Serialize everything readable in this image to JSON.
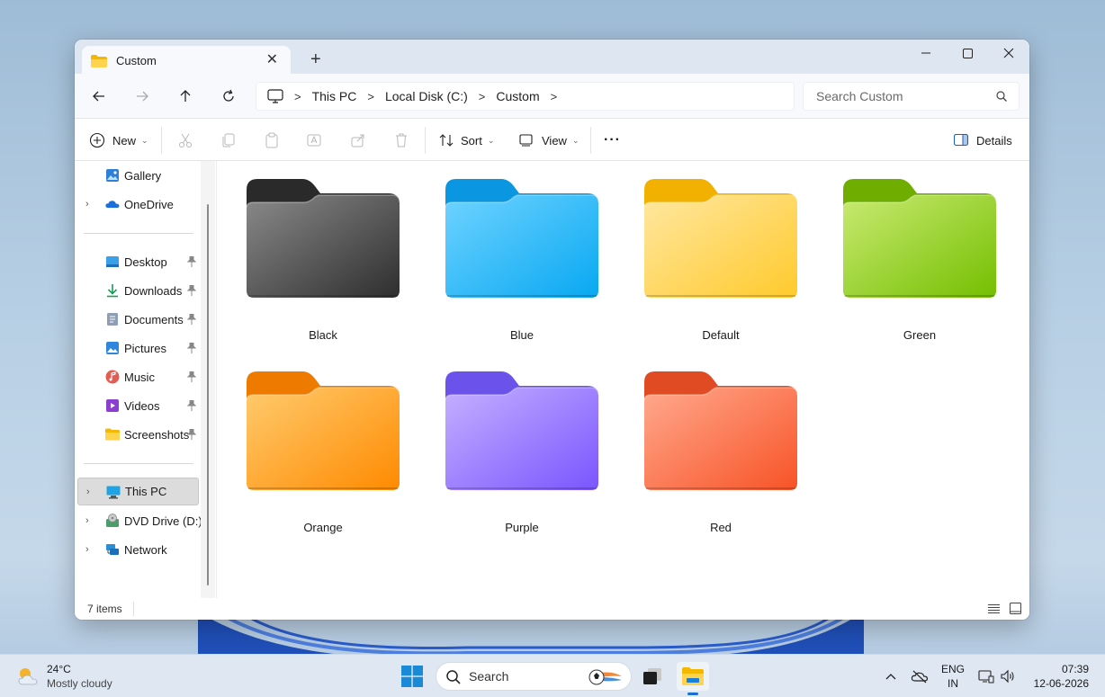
{
  "window": {
    "tab_title": "Custom",
    "tab_close": "✕",
    "new_tab": "+"
  },
  "address": {
    "crumbs": [
      "This PC",
      "Local Disk (C:)",
      "Custom"
    ],
    "sep": ">"
  },
  "search": {
    "placeholder": "Search Custom"
  },
  "toolbar": {
    "new_label": "New",
    "sort_label": "Sort",
    "view_label": "View",
    "more_label": "···",
    "details_label": "Details",
    "chev": "⌄"
  },
  "sidebar": {
    "items": [
      {
        "label": "Gallery",
        "icon": "gallery-icon"
      },
      {
        "label": "OneDrive",
        "icon": "onedrive-icon"
      },
      {
        "label": "Desktop",
        "icon": "desktop-icon",
        "pinned": true
      },
      {
        "label": "Downloads",
        "icon": "downloads-icon",
        "pinned": true
      },
      {
        "label": "Documents",
        "icon": "documents-icon",
        "pinned": true
      },
      {
        "label": "Pictures",
        "icon": "pictures-icon",
        "pinned": true
      },
      {
        "label": "Music",
        "icon": "music-icon",
        "pinned": true
      },
      {
        "label": "Videos",
        "icon": "videos-icon",
        "pinned": true
      },
      {
        "label": "Screenshots",
        "icon": "folder-icon",
        "pinned": true
      },
      {
        "label": "This PC",
        "icon": "this-pc-icon"
      },
      {
        "label": "DVD Drive (D:) C",
        "icon": "dvd-drive-icon"
      },
      {
        "label": "Network",
        "icon": "network-icon"
      }
    ],
    "expander": "›"
  },
  "folders": [
    {
      "label": "Black",
      "tab": "#2a2a2a",
      "top": "#8a8a8a",
      "bottom": "#2e2e2e"
    },
    {
      "label": "Blue",
      "tab": "#0a96e0",
      "top": "#6fd3ff",
      "bottom": "#08a8f2"
    },
    {
      "label": "Default",
      "tab": "#f2b000",
      "top": "#ffe7a0",
      "bottom": "#ffca2c"
    },
    {
      "label": "Green",
      "tab": "#6fae00",
      "top": "#c9ea72",
      "bottom": "#74bf00"
    },
    {
      "label": "Orange",
      "tab": "#ee7a00",
      "top": "#ffcb6e",
      "bottom": "#ff8a00"
    },
    {
      "label": "Purple",
      "tab": "#6a52ea",
      "top": "#c4b0ff",
      "bottom": "#7a55ff"
    },
    {
      "label": "Red",
      "tab": "#e04b23",
      "top": "#ffa98e",
      "bottom": "#f85326"
    }
  ],
  "status": {
    "count": "7 items"
  },
  "taskbar": {
    "temp": "24°C",
    "weather": "Mostly cloudy",
    "search_label": "Search",
    "lang": "ENG",
    "region": "IN",
    "time": "07:39",
    "date": "12-06-2026"
  }
}
